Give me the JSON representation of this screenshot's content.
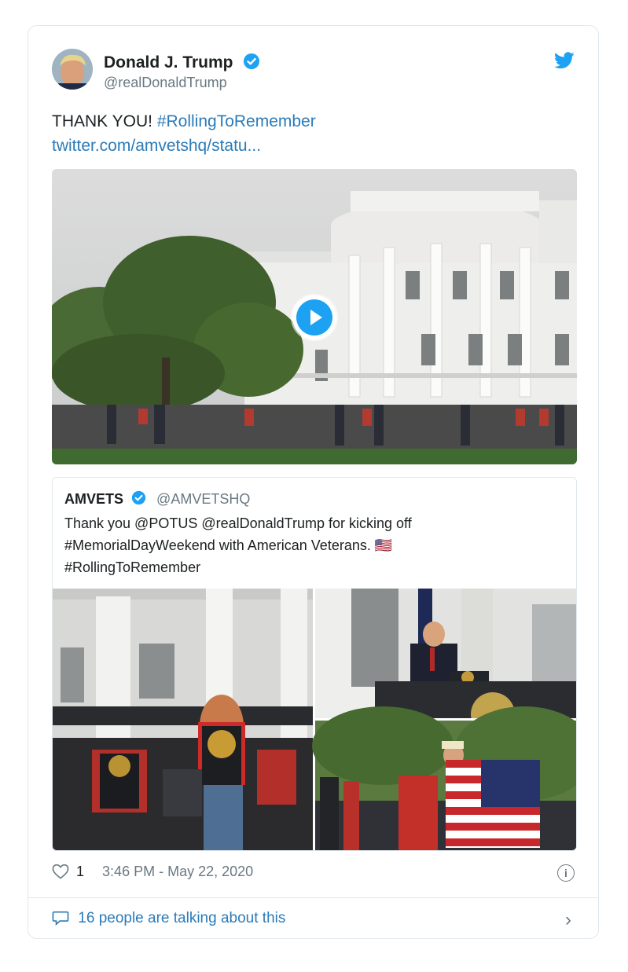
{
  "author": {
    "name": "Donald J. Trump",
    "handle": "@realDonaldTrump"
  },
  "tweet": {
    "text_plain": "THANK YOU! ",
    "hashtag": "#RollingToRemember",
    "link": "twitter.com/amvetshq/statu..."
  },
  "quoted": {
    "name": "AMVETS",
    "handle": "@AMVETSHQ",
    "line1": "Thank you @POTUS @realDonaldTrump for kicking off",
    "line2": "#MemorialDayWeekend with American Veterans. 🇺🇸",
    "line3": "#RollingToRemember"
  },
  "footer": {
    "likes": "1",
    "timestamp": "3:46 PM - May 22, 2020",
    "talking": "16 people are talking about this",
    "info_glyph": "i",
    "chevron_glyph": "›"
  },
  "colors": {
    "link": "#2b7bb9",
    "verified": "#1da1f2",
    "twitter_bird": "#1da1f2",
    "muted": "#697882",
    "border": "#e1e8ed"
  },
  "icons": [
    "verified-badge-icon",
    "twitter-bird-icon",
    "play-icon",
    "heart-icon",
    "info-icon",
    "speech-bubble-icon",
    "chevron-right-icon"
  ]
}
